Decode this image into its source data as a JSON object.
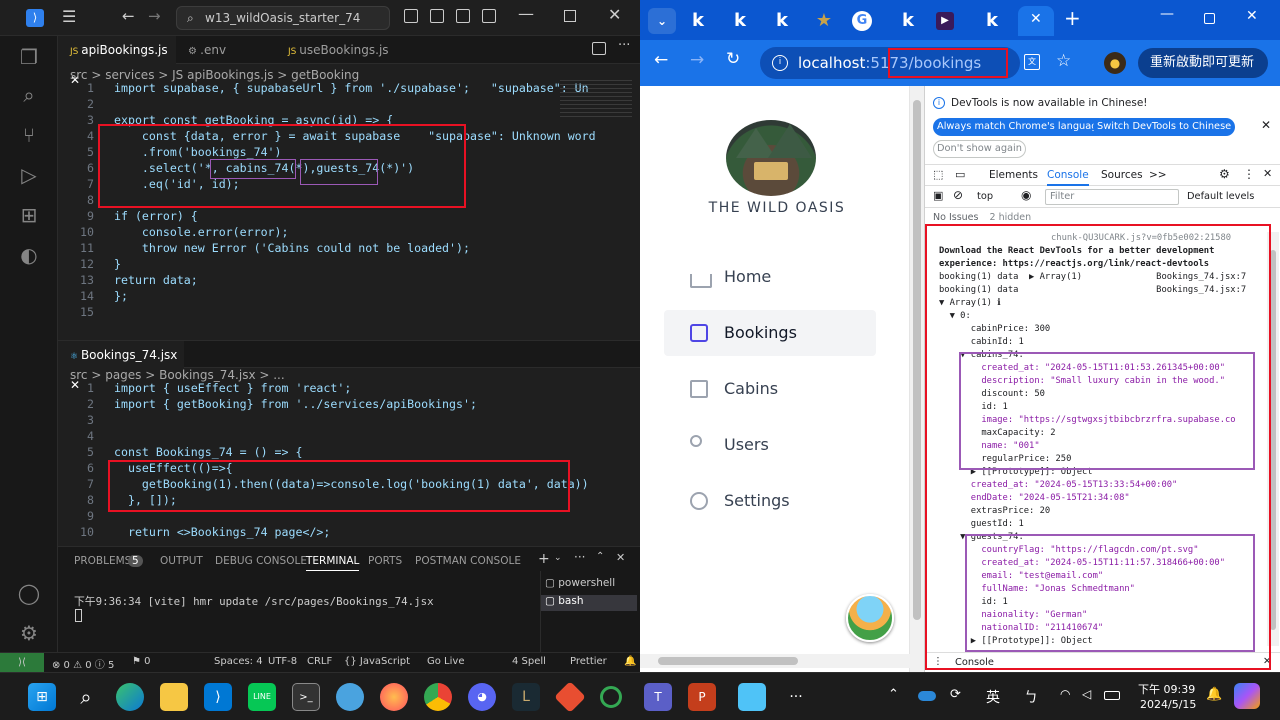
{
  "vscode": {
    "search": "w13_wildOasis_starter_74",
    "tabs": [
      "apiBookings.js",
      ".env",
      "useBookings.js"
    ],
    "crumbs1": "src > services > JS apiBookings.js > getBooking",
    "editor1": [
      {
        "n": "1",
        "t": "import supabase, { supabaseUrl } from './supabase';   \"supabase\": Un"
      },
      {
        "n": "2",
        "t": ""
      },
      {
        "n": "3",
        "t": "export const getBooking = async(id) => {"
      },
      {
        "n": "4",
        "t": "    const {data, error } = await supabase    \"supabase\": Unknown word"
      },
      {
        "n": "5",
        "t": "    .from('bookings_74')"
      },
      {
        "n": "6",
        "t": "    .select('*, cabins_74(*),guests_74(*)')"
      },
      {
        "n": "7",
        "t": "    .eq('id', id);"
      },
      {
        "n": "8",
        "t": ""
      },
      {
        "n": "9",
        "t": "if (error) {"
      },
      {
        "n": "10",
        "t": "    console.error(error);"
      },
      {
        "n": "11",
        "t": "    throw new Error ('Cabins could not be loaded');"
      },
      {
        "n": "12",
        "t": "}"
      },
      {
        "n": "13",
        "t": "return data;"
      },
      {
        "n": "14",
        "t": "};"
      },
      {
        "n": "15",
        "t": ""
      }
    ],
    "tab2": "Bookings_74.jsx",
    "crumbs2": "src > pages > Bookings_74.jsx > ...",
    "editor2": [
      {
        "n": "1",
        "t": "import { useEffect } from 'react';"
      },
      {
        "n": "2",
        "t": "import { getBooking} from '../services/apiBookings';"
      },
      {
        "n": "3",
        "t": ""
      },
      {
        "n": "4",
        "t": ""
      },
      {
        "n": "5",
        "t": "const Bookings_74 = () => {"
      },
      {
        "n": "6",
        "t": "  useEffect(()=>{"
      },
      {
        "n": "7",
        "t": "    getBooking(1).then((data)=>console.log('booking(1) data', data))"
      },
      {
        "n": "8",
        "t": "  }, []);"
      },
      {
        "n": "9",
        "t": ""
      },
      {
        "n": "10",
        "t": "  return <>Bookings_74 page</>;"
      }
    ],
    "panel_tabs": [
      "PROBLEMS",
      "5",
      "OUTPUT",
      "DEBUG CONSOLE",
      "TERMINAL",
      "PORTS",
      "POSTMAN CONSOLE"
    ],
    "terminal_line": "下午9:36:34 [vite] hmr update /src/pages/Bookings_74.jsx",
    "shells": [
      "powershell",
      "bash"
    ],
    "status": [
      "⊗ 0 ⚠ 0 ⓘ 5",
      "⚑ 0",
      "Spaces: 4",
      "UTF-8",
      "CRLF",
      "{} JavaScript",
      "Go Live",
      "4 Spell",
      "Prettier"
    ]
  },
  "chrome": {
    "tabs": [
      "k",
      "k",
      "k",
      "★",
      "G",
      "k",
      "▶",
      "k"
    ],
    "url_host": "localhost",
    "url_port": ":5173",
    "url_path": "/bookings",
    "update_button": "重新啟動即可更新",
    "app_name": "THE WILD OASIS",
    "nav": [
      "Home",
      "Bookings",
      "Cabins",
      "Users",
      "Settings"
    ]
  },
  "devtools": {
    "banner": "DevTools is now available in Chinese!",
    "btn_match": "Always match Chrome's language",
    "btn_switch": "Switch DevTools to Chinese",
    "btn_dont": "Don't show again",
    "tabs": [
      "Elements",
      "Console",
      "Sources",
      ">>"
    ],
    "context": "top",
    "filter_placeholder": "Filter",
    "levels": "Default levels",
    "issues": "No Issues",
    "hidden": "2 hidden",
    "drawer": "Console",
    "lines": [
      "chunk-QU3UCARK.js?v=0fb5e002:21580",
      "Download the React DevTools for a better development",
      "experience: https://reactjs.org/link/react-devtools",
      "booking(1) data  ▶ Array(1)              Bookings_74.jsx:7",
      "booking(1) data                          Bookings_74.jsx:7",
      "▼ Array(1) ℹ",
      "  ▼ 0:",
      "      cabinPrice: 300",
      "      cabinId: 1",
      "    ▼ cabins_74:",
      "        created_at: \"2024-05-15T11:01:53.261345+00:00\"",
      "        description: \"Small luxury cabin in the wood.\"",
      "        discount: 50",
      "        id: 1",
      "        image: \"https://sgtwgxsjtbibcbrzrfra.supabase.co",
      "        maxCapacity: 2",
      "        name: \"001\"",
      "        regularPrice: 250",
      "      ▶ [[Prototype]]: Object",
      "      created_at: \"2024-05-15T13:33:54+00:00\"",
      "      endDate: \"2024-05-15T21:34:08\"",
      "      extrasPrice: 20",
      "      guestId: 1",
      "    ▼ guests_74:",
      "        countryFlag: \"https://flagcdn.com/pt.svg\"",
      "        created_at: \"2024-05-15T11:11:57.318466+00:00\"",
      "        email: \"test@email.com\"",
      "        fullName: \"Jonas Schmedtmann\"",
      "        id: 1",
      "        naionality: \"German\"",
      "        nationalID: \"211410674\"",
      "      ▶ [[Prototype]]: Object"
    ]
  },
  "taskbar": {
    "time": "下午 09:39",
    "date": "2024/5/15",
    "ime": "英",
    "ime2": "ㄅ"
  }
}
